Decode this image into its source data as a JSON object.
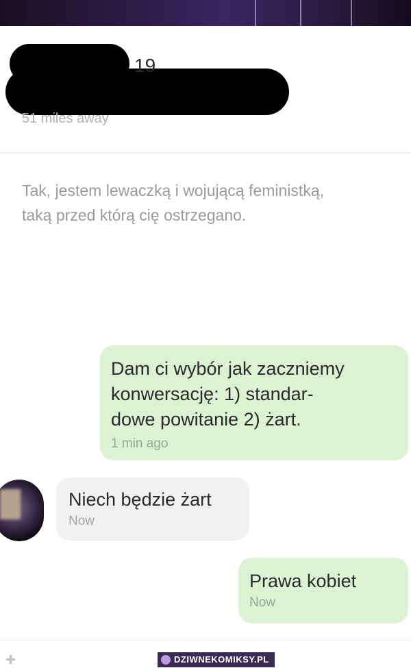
{
  "profile": {
    "age": "19",
    "distance": "51 miles away"
  },
  "bio": {
    "line1": "Tak, jestem lewaczką i wojującą feministką,",
    "line2": "taką przed którą cię ostrzegano."
  },
  "messages": [
    {
      "direction": "outgoing",
      "lines": [
        "Dam ci wybór jak zaczniemy",
        "konwersację: 1) standar-",
        "dowe powitanie 2) żart."
      ],
      "time": "1 min ago"
    },
    {
      "direction": "incoming",
      "lines": [
        "Niech będzie żart"
      ],
      "time": "Now"
    },
    {
      "direction": "outgoing",
      "lines": [
        "Prawa kobiet"
      ],
      "time": "Now"
    }
  ],
  "watermark": {
    "text": "DZIWNEKOMIKSY.PL"
  },
  "colors": {
    "outgoing_bubble": "#ddf2d2",
    "incoming_bubble": "#f1f1f1",
    "redaction": "#000000"
  }
}
